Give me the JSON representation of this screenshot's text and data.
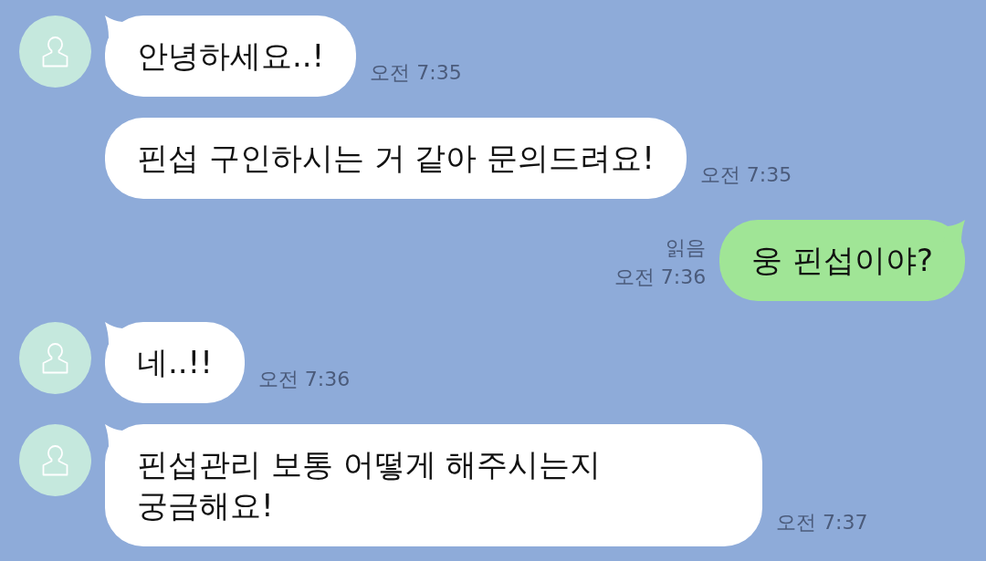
{
  "chat": {
    "messages": [
      {
        "kind": "received",
        "avatar": true,
        "text": "안녕하세요..!",
        "time": "오전 7:35"
      },
      {
        "kind": "received",
        "avatar": false,
        "text": "핀섭 구인하시는 거 같아 문의드려요!",
        "time": "오전 7:35"
      },
      {
        "kind": "sent",
        "read": "읽음",
        "text": "웅 핀섭이야?",
        "time": "오전 7:36"
      },
      {
        "kind": "received",
        "avatar": true,
        "text": "네..!!",
        "time": "오전 7:36"
      },
      {
        "kind": "received",
        "avatar": true,
        "text": "핀섭관리 보통 어떻게 해주시는지 궁금해요!",
        "time": "오전 7:37"
      }
    ]
  }
}
